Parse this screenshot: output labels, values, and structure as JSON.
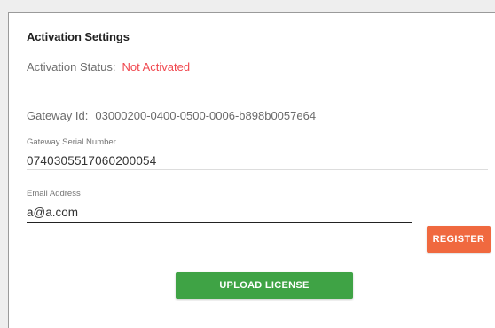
{
  "panel": {
    "title": "Activation Settings"
  },
  "activation_status": {
    "label": "Activation Status:",
    "value": "Not Activated",
    "value_color": "#f0484f"
  },
  "gateway_id": {
    "label": "Gateway Id:",
    "value": "03000200-0400-0500-0006-b898b0057e64"
  },
  "gateway_serial": {
    "label": "Gateway Serial Number",
    "value": "0740305517060200054"
  },
  "email": {
    "label": "Email Address",
    "value": "a@a.com"
  },
  "buttons": {
    "register_label": "REGISTER",
    "register_color": "#f0693f",
    "upload_label": "UPLOAD LICENSE",
    "upload_color": "#3fa345"
  }
}
